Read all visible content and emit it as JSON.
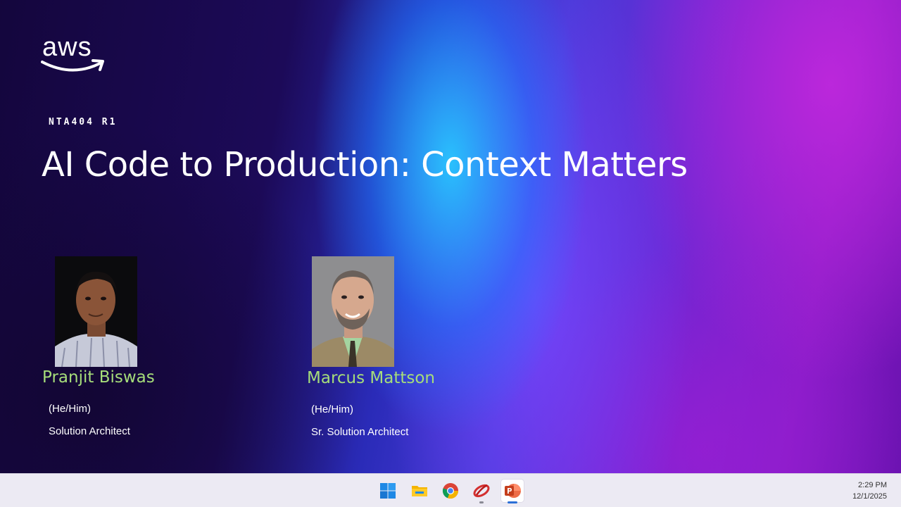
{
  "slide": {
    "logo": {
      "text": "aws",
      "icon": "aws-smile-arrow-icon"
    },
    "session_code": "NTA404 R1",
    "title": "AI Code to Production: Context Matters",
    "speakers": [
      {
        "name": "Pranjit Biswas",
        "pronouns": "(He/Him)",
        "role": "Solution Architect"
      },
      {
        "name": "Marcus Mattson",
        "pronouns": "(He/Him)",
        "role": "Sr. Solution Architect"
      }
    ],
    "colors": {
      "name_accent": "#a6dd7a",
      "text": "#ffffff"
    }
  },
  "taskbar": {
    "apps": [
      {
        "icon": "windows-start-icon",
        "active": false
      },
      {
        "icon": "file-explorer-icon",
        "active": false
      },
      {
        "icon": "chrome-icon",
        "active": false
      },
      {
        "icon": "red-swirl-app-icon",
        "active": false
      },
      {
        "icon": "powerpoint-icon",
        "active": true
      }
    ],
    "clock": {
      "time": "2:29 PM",
      "date": "12/1/2025"
    }
  }
}
